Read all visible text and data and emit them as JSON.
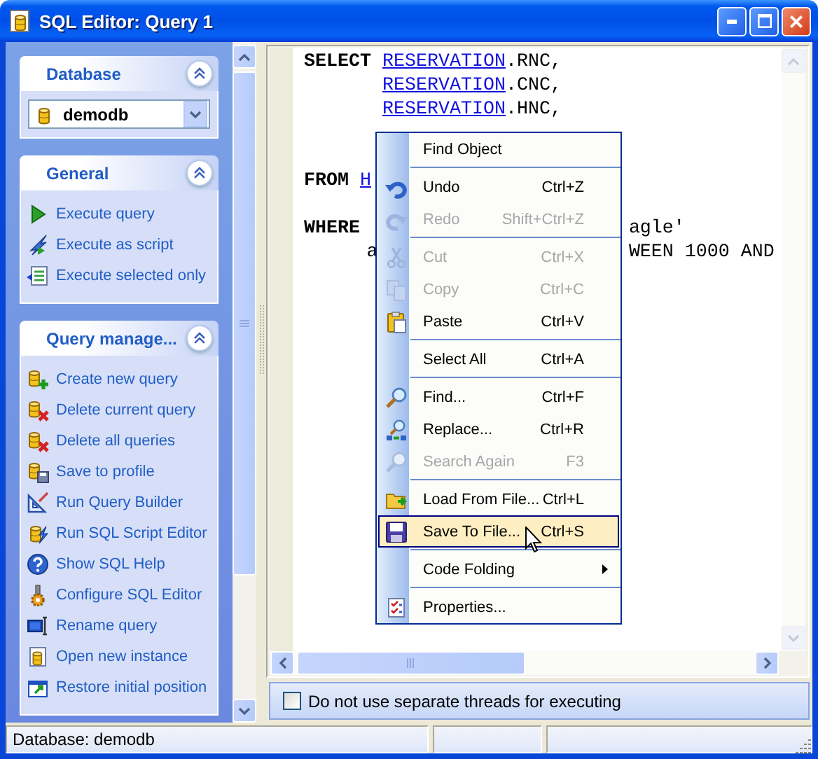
{
  "window": {
    "title": "SQL Editor: Query 1"
  },
  "sidebar": {
    "panels": [
      {
        "kind": "combo",
        "title": "Database",
        "expanded": true,
        "value": "demodb"
      },
      {
        "kind": "links",
        "title": "General",
        "expanded": true,
        "items": [
          {
            "label": "Execute query"
          },
          {
            "label": "Execute as script"
          },
          {
            "label": "Execute selected only"
          }
        ]
      },
      {
        "kind": "links",
        "title": "Query manage...",
        "expanded": true,
        "items": [
          {
            "label": "Create new query"
          },
          {
            "label": "Delete current query"
          },
          {
            "label": "Delete all queries"
          },
          {
            "label": "Save to profile"
          },
          {
            "label": "Run Query Builder"
          },
          {
            "label": "Run SQL Script Editor"
          },
          {
            "label": "Show SQL Help"
          },
          {
            "label": "Configure SQL Editor"
          },
          {
            "label": "Rename query"
          },
          {
            "label": "Open new instance"
          },
          {
            "label": "Restore initial position"
          }
        ]
      }
    ]
  },
  "editor": {
    "lines": [
      {
        "kind": "code",
        "keyword": "SELECT",
        "segments": [
          {
            "kind": "ident",
            "text": "RESERVATION"
          },
          {
            "kind": "plain",
            "text": ".RNC,"
          }
        ]
      },
      {
        "kind": "code",
        "indent": true,
        "segments": [
          {
            "kind": "ident",
            "text": "RESERVATION"
          },
          {
            "kind": "plain",
            "text": ".CNC,"
          }
        ]
      },
      {
        "kind": "code",
        "indent": true,
        "segments": [
          {
            "kind": "ident",
            "text": "RESERVATION"
          },
          {
            "kind": "plain",
            "text": ".HNC,"
          }
        ]
      },
      {
        "kind": "blank"
      },
      {
        "kind": "blank"
      },
      {
        "kind": "code",
        "keyword": "FROM",
        "segments": [
          {
            "kind": "ident",
            "text": "H"
          }
        ]
      },
      {
        "kind": "blank"
      },
      {
        "kind": "code",
        "keyword": "WHERE",
        "tail": "agle'"
      },
      {
        "kind": "code",
        "indent": false,
        "segments": [
          {
            "kind": "plain",
            "text": "a"
          }
        ],
        "tail": "WEEN 1000 AND"
      }
    ]
  },
  "context_menu": {
    "items": [
      {
        "kind": "item",
        "label": "Find Object",
        "disabled": false,
        "selected": false,
        "submenu": false
      },
      {
        "kind": "separator"
      },
      {
        "kind": "item",
        "label": "Undo",
        "shortcut": "Ctrl+Z",
        "disabled": false,
        "selected": false,
        "submenu": false
      },
      {
        "kind": "item",
        "label": "Redo",
        "shortcut": "Shift+Ctrl+Z",
        "disabled": true,
        "selected": false,
        "submenu": false
      },
      {
        "kind": "separator"
      },
      {
        "kind": "item",
        "label": "Cut",
        "shortcut": "Ctrl+X",
        "disabled": true,
        "selected": false,
        "submenu": false
      },
      {
        "kind": "item",
        "label": "Copy",
        "shortcut": "Ctrl+C",
        "disabled": true,
        "selected": false,
        "submenu": false
      },
      {
        "kind": "item",
        "label": "Paste",
        "shortcut": "Ctrl+V",
        "disabled": false,
        "selected": false,
        "submenu": false
      },
      {
        "kind": "separator"
      },
      {
        "kind": "item",
        "label": "Select All",
        "shortcut": "Ctrl+A",
        "disabled": false,
        "selected": false,
        "submenu": false
      },
      {
        "kind": "separator"
      },
      {
        "kind": "item",
        "label": "Find...",
        "shortcut": "Ctrl+F",
        "disabled": false,
        "selected": false,
        "submenu": false
      },
      {
        "kind": "item",
        "label": "Replace...",
        "shortcut": "Ctrl+R",
        "disabled": false,
        "selected": false,
        "submenu": false
      },
      {
        "kind": "item",
        "label": "Search Again",
        "shortcut": "F3",
        "disabled": true,
        "selected": false,
        "submenu": false
      },
      {
        "kind": "separator"
      },
      {
        "kind": "item",
        "label": "Load From File...",
        "shortcut": "Ctrl+L",
        "disabled": false,
        "selected": false,
        "submenu": false
      },
      {
        "kind": "item",
        "label": "Save To File...",
        "shortcut": "Ctrl+S",
        "disabled": false,
        "selected": true,
        "submenu": false
      },
      {
        "kind": "separator"
      },
      {
        "kind": "item",
        "label": "Code Folding",
        "disabled": false,
        "selected": false,
        "submenu": true
      },
      {
        "kind": "separator"
      },
      {
        "kind": "item",
        "label": "Properties...",
        "disabled": false,
        "selected": false,
        "submenu": false
      }
    ]
  },
  "options": {
    "checkbox": {
      "label": "Do not use separate threads for executing",
      "checked": false
    }
  },
  "status_bar": {
    "panels": [
      "Database: demodb"
    ]
  }
}
